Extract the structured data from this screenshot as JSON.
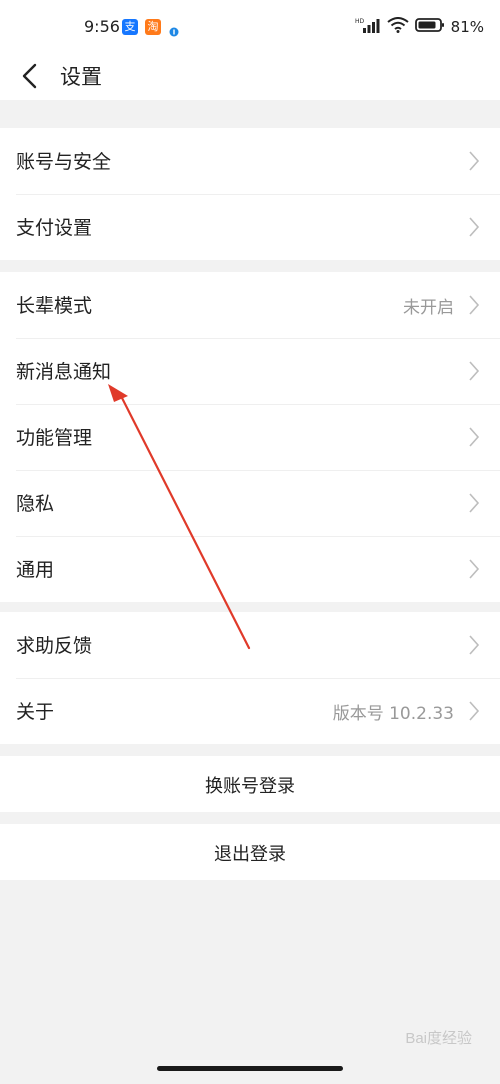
{
  "status": {
    "time": "9:56",
    "battery": "81%",
    "app_icons": [
      {
        "name": "alipay-icon",
        "glyph": "支",
        "color": "#1677ff"
      },
      {
        "name": "taobao-icon",
        "glyph": "淘",
        "color": "#ff7a1a"
      }
    ]
  },
  "header": {
    "title": "设置",
    "back_icon": "chevron-left-icon"
  },
  "groups": [
    {
      "items": [
        {
          "label": "账号与安全",
          "value": ""
        },
        {
          "label": "支付设置",
          "value": ""
        }
      ]
    },
    {
      "items": [
        {
          "label": "长辈模式",
          "value": "未开启"
        },
        {
          "label": "新消息通知",
          "value": ""
        },
        {
          "label": "功能管理",
          "value": ""
        },
        {
          "label": "隐私",
          "value": ""
        },
        {
          "label": "通用",
          "value": ""
        }
      ]
    },
    {
      "items": [
        {
          "label": "求助反馈",
          "value": ""
        },
        {
          "label": "关于",
          "value": "版本号 10.2.33"
        }
      ]
    }
  ],
  "actions": {
    "switch_account": "换账号登录",
    "logout": "退出登录"
  },
  "watermark": "Bai度经验",
  "colors": {
    "annotation_arrow": "#e03a2a",
    "background": "#f2f2f2"
  }
}
